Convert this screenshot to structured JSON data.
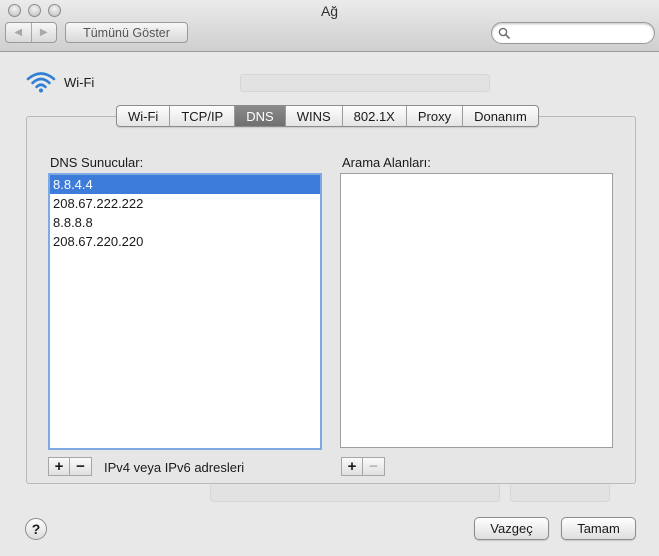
{
  "window": {
    "title": "Ağ"
  },
  "toolbar": {
    "show_all_label": "Tümünü Göster",
    "search_placeholder": ""
  },
  "network": {
    "interface_label": "Wi-Fi"
  },
  "tabs": [
    {
      "label": "Wi-Fi",
      "active": false
    },
    {
      "label": "TCP/IP",
      "active": false
    },
    {
      "label": "DNS",
      "active": true
    },
    {
      "label": "WINS",
      "active": false
    },
    {
      "label": "802.1X",
      "active": false
    },
    {
      "label": "Proxy",
      "active": false
    },
    {
      "label": "Donanım",
      "active": false
    }
  ],
  "dns": {
    "servers_label": "DNS Sunucular:",
    "servers": [
      "8.8.4.4",
      "208.67.222.222",
      "8.8.8.8",
      "208.67.220.220"
    ],
    "selected_index": 0,
    "address_hint": "IPv4 veya IPv6 adresleri"
  },
  "search_domains": {
    "label": "Arama Alanları:",
    "items": []
  },
  "footer": {
    "help_label": "?",
    "cancel_label": "Vazgeç",
    "ok_label": "Tamam"
  },
  "colors": {
    "selection": "#3d7cd9",
    "focus_ring": "#7fa9e3",
    "active_tab": "#7d7d7d",
    "wifi_icon": "#2f7fd4"
  }
}
